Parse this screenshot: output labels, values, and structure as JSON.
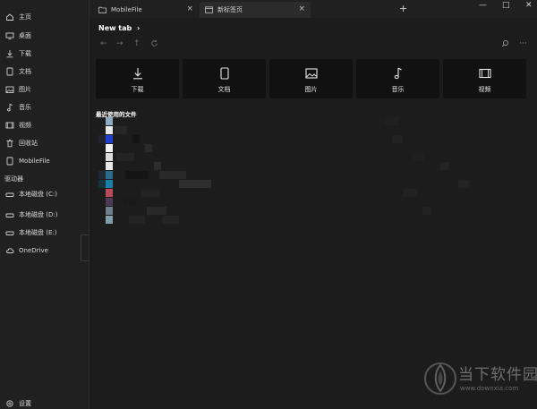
{
  "sidebar": {
    "items": [
      {
        "label": "主页",
        "icon": "home-icon"
      },
      {
        "label": "桌面",
        "icon": "desktop-icon"
      },
      {
        "label": "下载",
        "icon": "download-icon"
      },
      {
        "label": "文档",
        "icon": "document-icon"
      },
      {
        "label": "图片",
        "icon": "image-icon"
      },
      {
        "label": "音乐",
        "icon": "music-icon"
      },
      {
        "label": "视频",
        "icon": "video-icon"
      },
      {
        "label": "回收站",
        "icon": "recycle-bin-icon"
      },
      {
        "label": "MobileFile",
        "icon": "folder-icon"
      }
    ],
    "drives_heading": "驱动器",
    "drives": [
      {
        "label": "本地磁盘 (C:)",
        "icon": "drive-icon"
      },
      {
        "label": "本地磁盘 (D:)",
        "icon": "drive-icon"
      },
      {
        "label": "本地磁盘 (E:)",
        "icon": "drive-icon"
      },
      {
        "label": "OneDrive",
        "icon": "cloud-icon"
      }
    ],
    "settings_label": "设置"
  },
  "tabs": [
    {
      "label": "MobileFile",
      "icon": "folder-icon",
      "active": false
    },
    {
      "label": "新标签页",
      "icon": "folder-icon",
      "active": true
    }
  ],
  "content": {
    "breadcrumb": "New tab",
    "quick_access": [
      {
        "label": "下载",
        "icon": "download-icon"
      },
      {
        "label": "文档",
        "icon": "document-icon"
      },
      {
        "label": "图片",
        "icon": "image-icon"
      },
      {
        "label": "音乐",
        "icon": "music-icon"
      },
      {
        "label": "视频",
        "icon": "video-icon"
      }
    ],
    "recent_heading": "最近使用的文件"
  },
  "watermark": {
    "brand": "当下软件园",
    "url": "www.downxia.com"
  },
  "colors": {
    "background": "#1c1c1c",
    "sidebar": "#202020",
    "active_tab": "#2b2b2b",
    "tile": "#111111"
  }
}
